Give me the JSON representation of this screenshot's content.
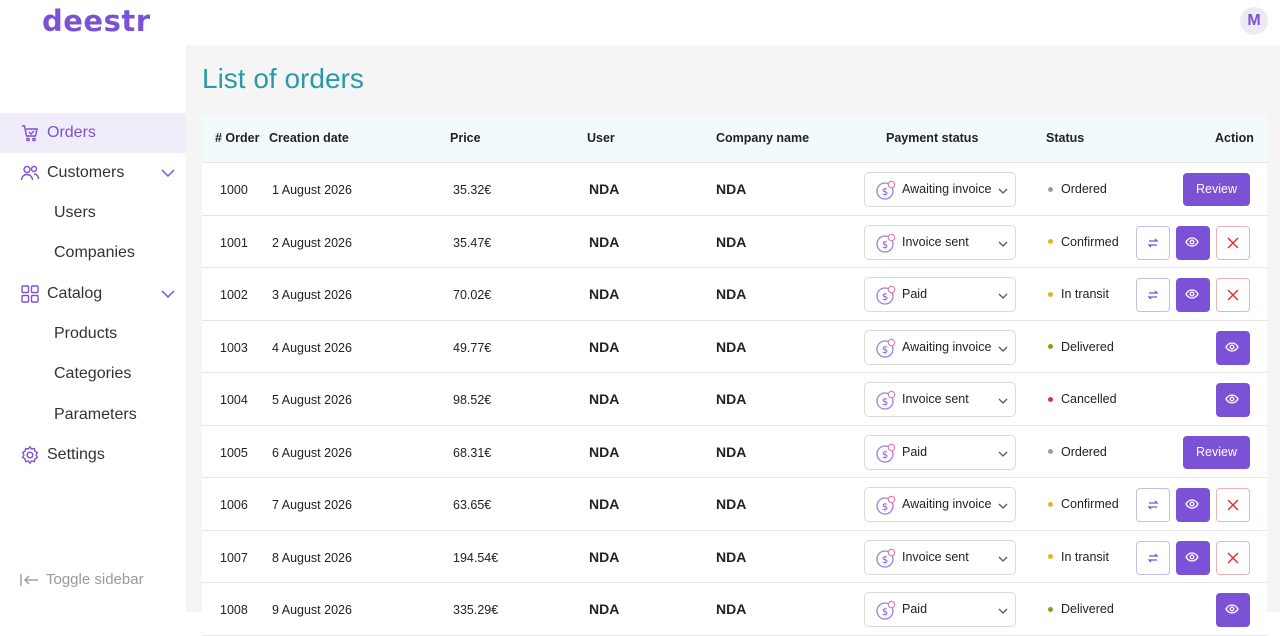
{
  "app": {
    "logo": "deestr",
    "avatar_initial": "M"
  },
  "sidebar": {
    "items": [
      {
        "label": "Orders"
      },
      {
        "label": "Customers"
      },
      {
        "label": "Users"
      },
      {
        "label": "Companies"
      },
      {
        "label": "Catalog"
      },
      {
        "label": "Products"
      },
      {
        "label": "Categories"
      },
      {
        "label": "Parameters"
      },
      {
        "label": "Settings"
      }
    ],
    "toggle_label": "Toggle sidebar"
  },
  "page": {
    "title": "List of orders"
  },
  "table": {
    "headers": {
      "order": "# Order",
      "date": "Creation date",
      "price": "Price",
      "user": "User",
      "company": "Company name",
      "payment": "Payment status",
      "status": "Status",
      "action": "Action"
    },
    "review_label": "Review",
    "rows": [
      {
        "order": "1000",
        "date": "1 August 2026",
        "price": "35.32€",
        "user": "NDA",
        "company": "NDA",
        "payment": "Awaiting invoice",
        "status": "Ordered",
        "status_color": "#9e9e9e",
        "actions": "review"
      },
      {
        "order": "1001",
        "date": "2 August 2026",
        "price": "35.47€",
        "user": "NDA",
        "company": "NDA",
        "payment": "Invoice sent",
        "status": "Confirmed",
        "status_color": "#e3b526",
        "actions": "full"
      },
      {
        "order": "1002",
        "date": "3 August 2026",
        "price": "70.02€",
        "user": "NDA",
        "company": "NDA",
        "payment": "Paid",
        "status": "In transit",
        "status_color": "#e3b526",
        "actions": "full"
      },
      {
        "order": "1003",
        "date": "4 August 2026",
        "price": "49.77€",
        "user": "NDA",
        "company": "NDA",
        "payment": "Awaiting invoice",
        "status": "Delivered",
        "status_color": "#7aa61e",
        "actions": "view"
      },
      {
        "order": "1004",
        "date": "5 August 2026",
        "price": "98.52€",
        "user": "NDA",
        "company": "NDA",
        "payment": "Invoice sent",
        "status": "Cancelled",
        "status_color": "#d93636",
        "actions": "view"
      },
      {
        "order": "1005",
        "date": "6 August 2026",
        "price": "68.31€",
        "user": "NDA",
        "company": "NDA",
        "payment": "Paid",
        "status": "Ordered",
        "status_color": "#9e9e9e",
        "actions": "review"
      },
      {
        "order": "1006",
        "date": "7 August 2026",
        "price": "63.65€",
        "user": "NDA",
        "company": "NDA",
        "payment": "Awaiting invoice",
        "status": "Confirmed",
        "status_color": "#e3b526",
        "actions": "full"
      },
      {
        "order": "1007",
        "date": "8 August 2026",
        "price": "194.54€",
        "user": "NDA",
        "company": "NDA",
        "payment": "Invoice sent",
        "status": "In transit",
        "status_color": "#e3b526",
        "actions": "full"
      },
      {
        "order": "1008",
        "date": "9 August 2026",
        "price": "335.29€",
        "user": "NDA",
        "company": "NDA",
        "payment": "Paid",
        "status": "Delivered",
        "status_color": "#7aa61e",
        "actions": "view"
      }
    ]
  },
  "colors": {
    "accent": "#7b52d6",
    "title": "#2a9aa5",
    "danger": "#d93636"
  }
}
